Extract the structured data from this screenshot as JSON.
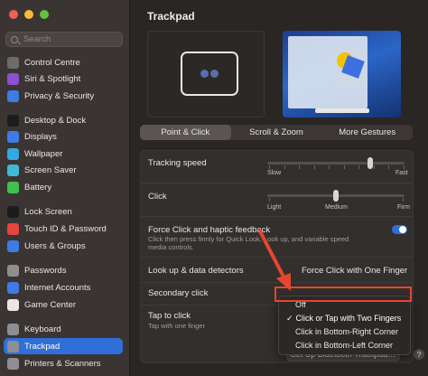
{
  "window": {
    "title": "Trackpad"
  },
  "colors": {
    "accent": "#2f6fd9",
    "highlight": "#e8452f"
  },
  "sidebar": {
    "search_placeholder": "Search",
    "items": [
      {
        "label": "Control Centre",
        "icon": "control-centre-icon",
        "color": "#6c6c70"
      },
      {
        "label": "Siri & Spotlight",
        "icon": "siri-icon",
        "color": "#8e4fd1"
      },
      {
        "label": "Privacy & Security",
        "icon": "privacy-hand-icon",
        "color": "#3e7be6"
      },
      {
        "label": "Desktop & Dock",
        "icon": "desktop-dock-icon",
        "color": "#1c1c1e"
      },
      {
        "label": "Displays",
        "icon": "displays-icon",
        "color": "#3e7be6"
      },
      {
        "label": "Wallpaper",
        "icon": "wallpaper-icon",
        "color": "#34a8e0"
      },
      {
        "label": "Screen Saver",
        "icon": "screen-saver-icon",
        "color": "#3fb8d9"
      },
      {
        "label": "Battery",
        "icon": "battery-icon",
        "color": "#3ec24d"
      },
      {
        "label": "Lock Screen",
        "icon": "lock-icon",
        "color": "#1c1c1e"
      },
      {
        "label": "Touch ID & Password",
        "icon": "fingerprint-icon",
        "color": "#e8453c"
      },
      {
        "label": "Users & Groups",
        "icon": "users-icon",
        "color": "#3e7be6"
      },
      {
        "label": "Passwords",
        "icon": "key-icon",
        "color": "#8e8e93"
      },
      {
        "label": "Internet Accounts",
        "icon": "at-icon",
        "color": "#3e7be6"
      },
      {
        "label": "Game Center",
        "icon": "game-center-icon",
        "color": "#e9e6e3"
      },
      {
        "label": "Keyboard",
        "icon": "keyboard-icon",
        "color": "#8e8e93"
      },
      {
        "label": "Trackpad",
        "icon": "trackpad-icon",
        "color": "#8e8e93"
      },
      {
        "label": "Printers & Scanners",
        "icon": "printer-icon",
        "color": "#8e8e93"
      }
    ]
  },
  "tabs": [
    "Point & Click",
    "Scroll & Zoom",
    "More Gestures"
  ],
  "settings": {
    "tracking_speed": {
      "label": "Tracking speed",
      "min": "Slow",
      "max": "Fast",
      "value": 0.75
    },
    "click": {
      "label": "Click",
      "stops": [
        "Light",
        "Medium",
        "Firm"
      ],
      "value": "Medium"
    },
    "force_click": {
      "label": "Force Click and haptic feedback",
      "desc": "Click then press firmly for Quick Look, Look up, and variable speed media controls.",
      "on": true
    },
    "lookup": {
      "label": "Look up & data detectors",
      "value": "Force Click with One Finger"
    },
    "secondary": {
      "label": "Secondary click"
    },
    "tap": {
      "label": "Tap to click",
      "desc": "Tap with one finger"
    }
  },
  "menu": {
    "items": [
      "Off",
      "Click or Tap with Two Fingers",
      "Click in Bottom-Right Corner",
      "Click in Bottom-Left Corner"
    ],
    "selected": "Click or Tap with Two Fingers",
    "check": "✓"
  },
  "bt_button": "Set Up Bluetooth Trackpad…",
  "help": "?"
}
